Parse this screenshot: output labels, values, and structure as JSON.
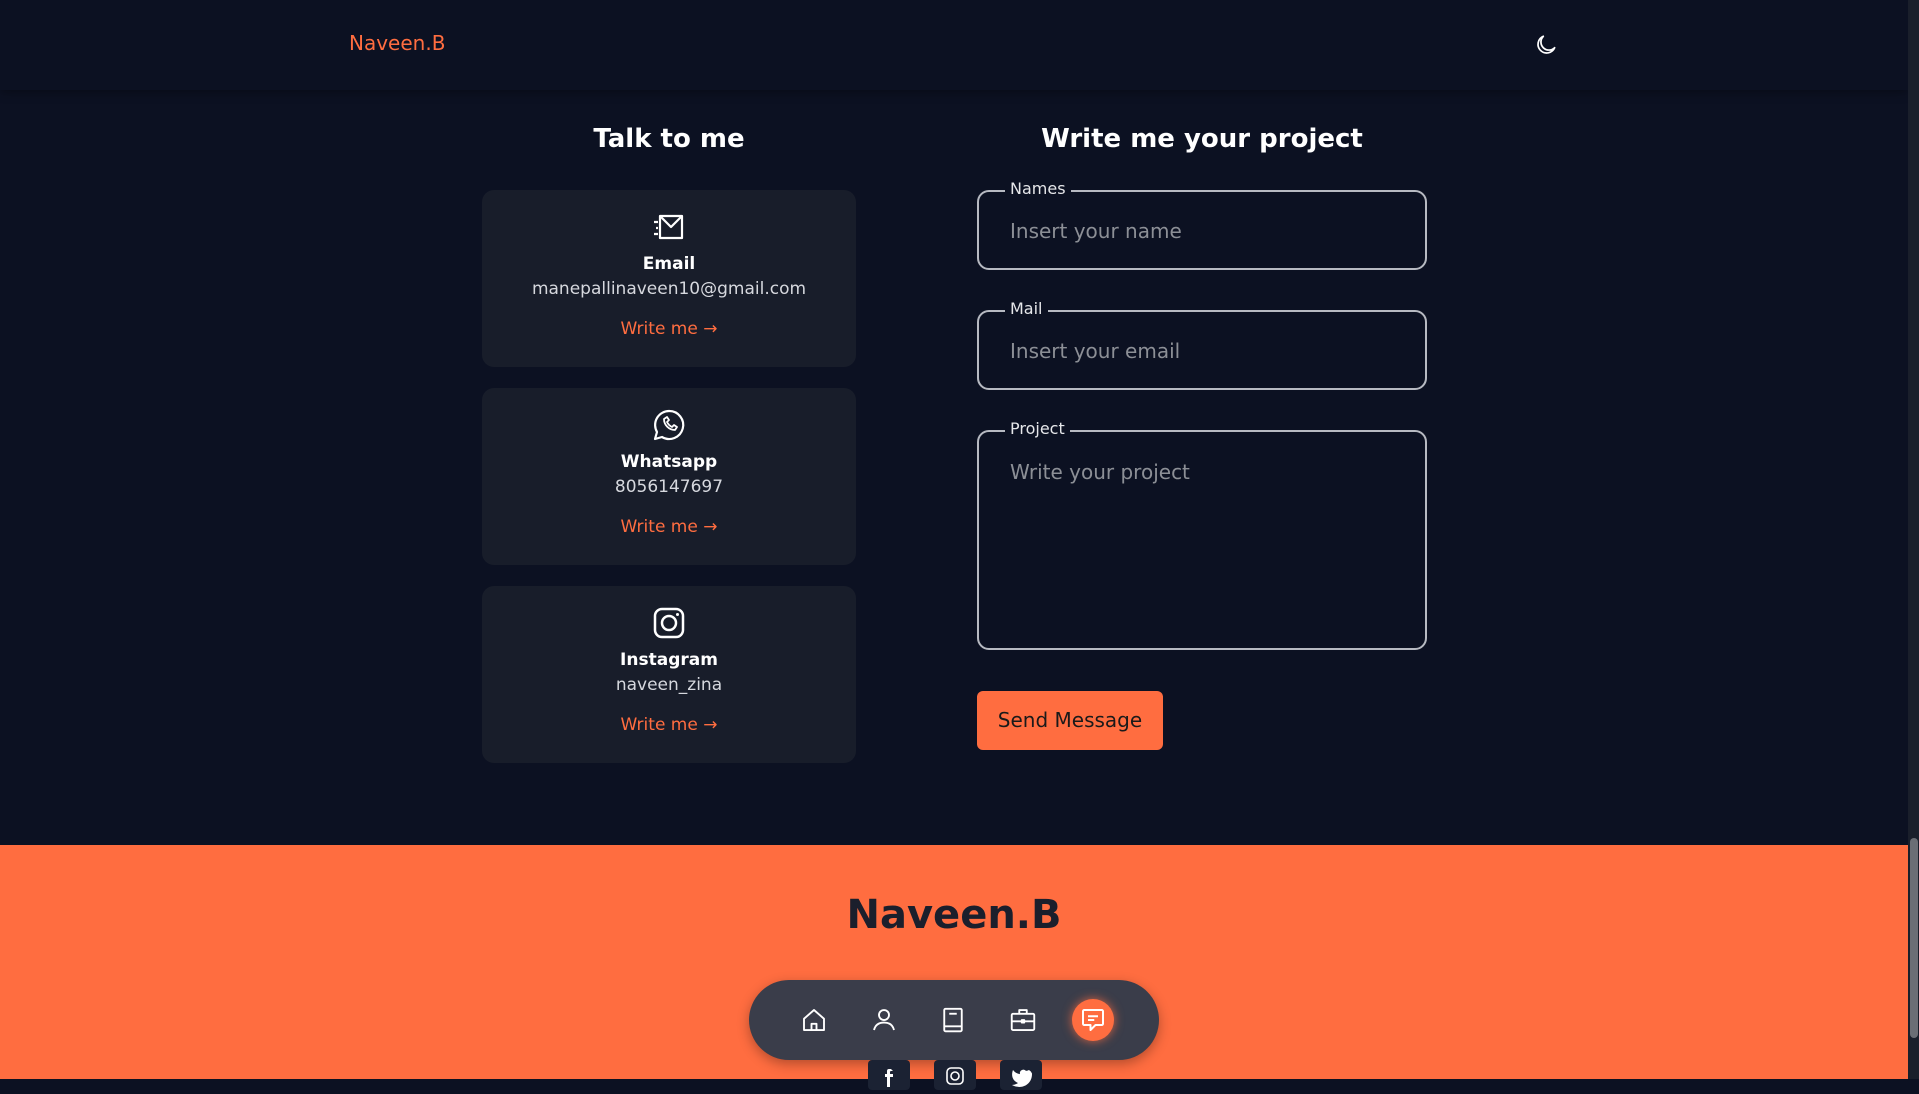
{
  "header": {
    "logo": "Naveen.B",
    "theme_icon": "moon-icon"
  },
  "contact": {
    "title": "Talk to me",
    "cards": [
      {
        "icon": "email-icon",
        "title": "Email",
        "data": "manepallinaveen10@gmail.com",
        "link": "Write me →"
      },
      {
        "icon": "whatsapp-icon",
        "title": "Whatsapp",
        "data": "8056147697",
        "link": "Write me →"
      },
      {
        "icon": "instagram-icon",
        "title": "Instagram",
        "data": "naveen_zina",
        "link": "Write me →"
      }
    ]
  },
  "form": {
    "title": "Write me your project",
    "fields": [
      {
        "label": "Names",
        "placeholder": "Insert your name",
        "value": ""
      },
      {
        "label": "Mail",
        "placeholder": "Insert your email",
        "value": ""
      },
      {
        "label": "Project",
        "placeholder": "Write your project",
        "value": ""
      }
    ],
    "submit": "Send Message"
  },
  "footer": {
    "title": "Naveen.B",
    "nav": [
      "home-icon",
      "user-icon",
      "book-icon",
      "briefcase-icon",
      "message-icon"
    ],
    "active_nav": "message-icon",
    "socials": [
      "facebook-icon",
      "instagram-icon",
      "twitter-icon"
    ]
  },
  "colors": {
    "background": "#0c1122",
    "accent": "#ff6d40",
    "card": "#181d2a",
    "nav": "#3a3d4a"
  }
}
